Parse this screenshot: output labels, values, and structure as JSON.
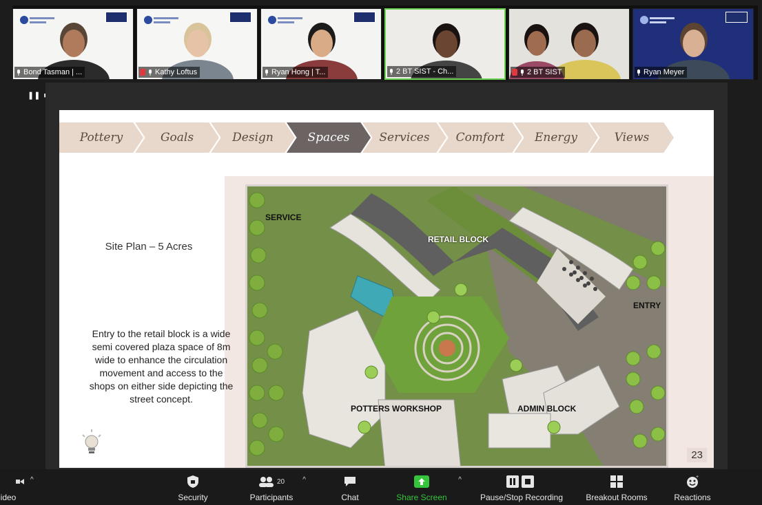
{
  "participants": [
    {
      "name": "Bond Tasman | ...",
      "muted": false,
      "bg": "#f5f5f3",
      "skin": "#b07b5d",
      "shirt": "#2b2b2b",
      "hair": "#5a4636"
    },
    {
      "name": "Kathy Loftus",
      "muted": true,
      "bg": "#f6f6f4",
      "skin": "#e6c2a6",
      "shirt": "#7b8590",
      "hair": "#d8c39a"
    },
    {
      "name": "Ryan Hong | T...",
      "muted": false,
      "bg": "#f4f4f2",
      "skin": "#d9ab86",
      "shirt": "#8a3b3b",
      "hair": "#1b1b1b"
    },
    {
      "name": "2 BT SIST - Ch...",
      "muted": false,
      "bg": "#eeece8",
      "skin": "#6a4532",
      "shirt": "#444",
      "hair": "#1a1210",
      "active": true
    },
    {
      "name": "2 BT SIST",
      "muted": true,
      "bg": "#e4e2dd",
      "skin": "#9a6b4e",
      "shirt": "#d9c55a",
      "hair": "#1a1210"
    },
    {
      "name": "Ryan Meyer",
      "muted": false,
      "bg": "#1f2f7a",
      "skin": "#d8b195",
      "shirt": "#3d4a5a",
      "hair": "#5c4332"
    }
  ],
  "slide": {
    "tabs": [
      "Pottery",
      "Goals",
      "Design",
      "Spaces",
      "Services",
      "Comfort",
      "Energy",
      "Views"
    ],
    "active_tab": "Spaces",
    "title": "Site Plan – 5 Acres",
    "description": "Entry to the retail block is a wide semi covered plaza space of 8m wide to enhance the circulation movement and access to the shops on either side depicting the street concept.",
    "plan_labels": {
      "service": "SERVICE",
      "retail": "RETAIL BLOCK",
      "entry": "ENTRY",
      "potters": "POTTERS WORKSHOP",
      "admin": "ADMIN BLOCK"
    },
    "page_number": "23"
  },
  "toolbar": {
    "video": "ideo",
    "security": "Security",
    "participants": "Participants",
    "participants_count": "20",
    "chat": "Chat",
    "share": "Share Screen",
    "record": "Pause/Stop Recording",
    "breakout": "Breakout Rooms",
    "reactions": "Reactions"
  },
  "colors": {
    "share_green": "#35c43c",
    "active_tile": "#6bd44f",
    "slide_active_tab": "#6b6462",
    "slide_tab": "#e7d8cb"
  }
}
